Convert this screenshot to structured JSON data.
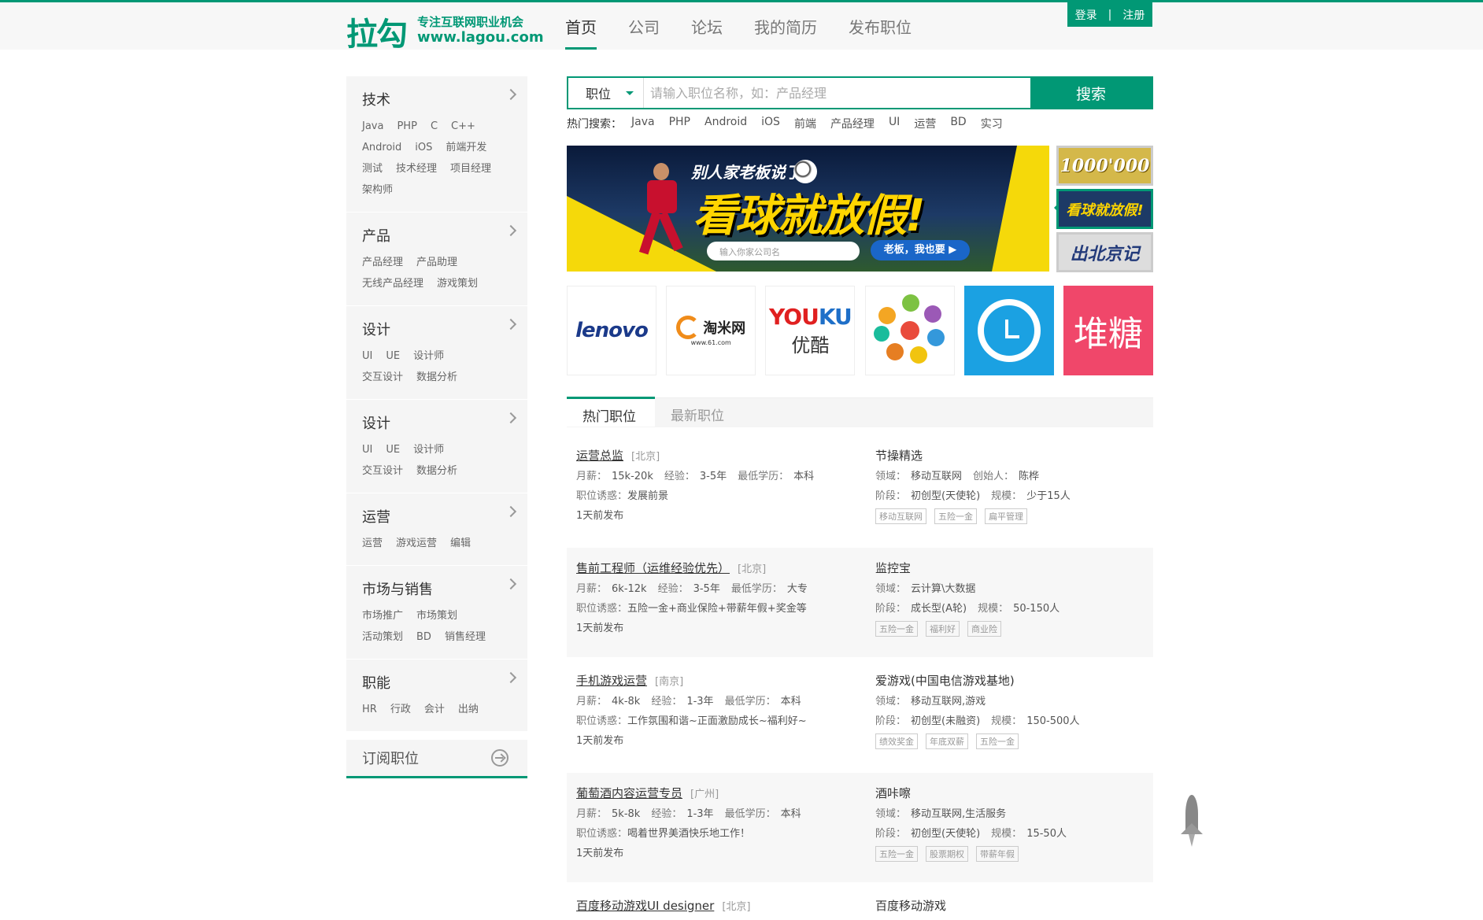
{
  "header": {
    "logo_main": "拉勾",
    "logo_slogan": "专注互联网职业机会",
    "logo_url": "www.lagou.com",
    "nav": [
      "首页",
      "公司",
      "论坛",
      "我的简历",
      "发布职位"
    ],
    "login": "登录",
    "register": "注册",
    "separator": "|"
  },
  "sidebar": {
    "categories": [
      {
        "title": "技术",
        "links": [
          "Java",
          "PHP",
          "C",
          "C++",
          "Android",
          "iOS",
          "前端开发",
          "测试",
          "技术经理",
          "项目经理",
          "架构师"
        ]
      },
      {
        "title": "产品",
        "links": [
          "产品经理",
          "产品助理",
          "无线产品经理",
          "游戏策划"
        ]
      },
      {
        "title": "设计",
        "links": [
          "UI",
          "UE",
          "设计师",
          "交互设计",
          "数据分析"
        ]
      },
      {
        "title": "设计",
        "links": [
          "UI",
          "UE",
          "设计师",
          "交互设计",
          "数据分析"
        ]
      },
      {
        "title": "运营",
        "links": [
          "运营",
          "游戏运营",
          "编辑"
        ]
      },
      {
        "title": "市场与销售",
        "links": [
          "市场推广",
          "市场策划",
          "活动策划",
          "BD",
          "销售经理"
        ]
      },
      {
        "title": "职能",
        "links": [
          "HR",
          "行政",
          "会计",
          "出纳"
        ]
      }
    ],
    "subscribe": "订阅职位"
  },
  "search": {
    "type": "职位",
    "placeholder": "请输入职位名称，如：产品经理",
    "button": "搜索",
    "hot_label": "热门搜索：",
    "hot": [
      "Java",
      "PHP",
      "Android",
      "iOS",
      "前端",
      "产品经理",
      "UI",
      "运营",
      "BD",
      "实习"
    ]
  },
  "banner": {
    "small_text": "别人家老板说了:",
    "big_text": "看球就放假!",
    "input_placeholder": "输入你家公司名",
    "cta": "老板，我也要 ▶",
    "thumbs": [
      "1000'000",
      "看球就放假!",
      "出北京记"
    ]
  },
  "logos": {
    "lenovo": "lenovo",
    "taomi": "淘米网",
    "taomi_url": "www.61.com",
    "youku_you": "YOU",
    "youku_ku": "KU",
    "youku_cn": "优酷",
    "duitang": "堆糖"
  },
  "tabs": [
    "热门职位",
    "最新职位"
  ],
  "labels": {
    "salary": "月薪：",
    "experience": "经验：",
    "education": "最低学历：",
    "perk": "职位诱惑：",
    "field": "领域：",
    "founder": "创始人：",
    "stage": "阶段：",
    "scale": "规模："
  },
  "jobs": [
    {
      "title": "运营总监",
      "city": "[北京]",
      "salary": "15k-20k",
      "exp": "3-5年",
      "edu": "本科",
      "perk": "发展前景",
      "posted": "1天前发布",
      "company": "节操精选",
      "field": "移动互联网",
      "founder": "陈桦",
      "stage": "初创型(天使轮)",
      "scale": "少于15人",
      "tags": [
        "移动互联网",
        "五险一金",
        "扁平管理"
      ]
    },
    {
      "title": "售前工程师（运维经验优先）",
      "city": "[北京]",
      "salary": "6k-12k",
      "exp": "3-5年",
      "edu": "大专",
      "perk": "五险一金+商业保险+带薪年假+奖金等",
      "posted": "1天前发布",
      "company": "监控宝",
      "field": "云计算\\大数据",
      "founder": "",
      "stage": "成长型(A轮)",
      "scale": "50-150人",
      "tags": [
        "五险一金",
        "福利好",
        "商业险"
      ]
    },
    {
      "title": "手机游戏运营",
      "city": "[南京]",
      "salary": "4k-8k",
      "exp": "1-3年",
      "edu": "本科",
      "perk": "工作氛围和谐~正面激励成长~福利好~",
      "posted": "1天前发布",
      "company": "爱游戏(中国电信游戏基地)",
      "field": "移动互联网,游戏",
      "founder": "",
      "stage": "初创型(未融资)",
      "scale": "150-500人",
      "tags": [
        "绩效奖金",
        "年底双薪",
        "五险一金"
      ]
    },
    {
      "title": "葡萄酒内容运营专员",
      "city": "[广州]",
      "salary": "5k-8k",
      "exp": "1-3年",
      "edu": "本科",
      "perk": "喝着世界美酒快乐地工作！",
      "posted": "1天前发布",
      "company": "酒咔嚓",
      "field": "移动互联网,生活服务",
      "founder": "",
      "stage": "初创型(天使轮)",
      "scale": "15-50人",
      "tags": [
        "五险一金",
        "股票期权",
        "带薪年假"
      ]
    },
    {
      "title": "百度移动游戏UI designer",
      "city": "[北京]",
      "company": "百度移动游戏"
    }
  ]
}
